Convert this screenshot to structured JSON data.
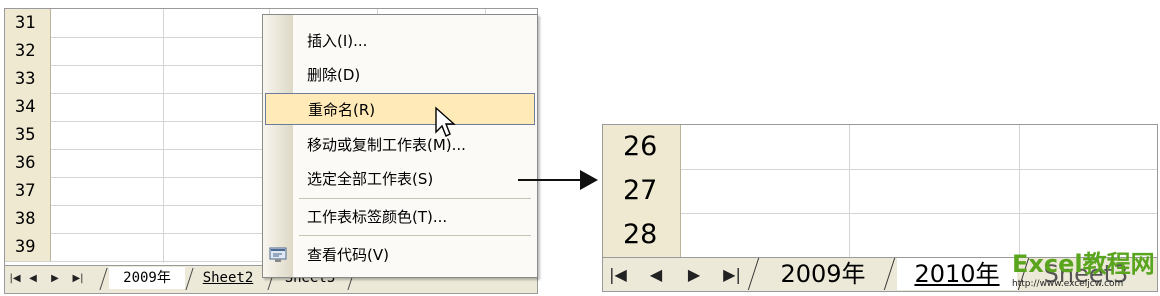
{
  "left_sheet": {
    "row_numbers": [
      "31",
      "32",
      "33",
      "34",
      "35",
      "36",
      "37",
      "38",
      "39"
    ],
    "nav_buttons": [
      "|◀",
      "◀",
      "▶",
      "▶|"
    ],
    "tabs": [
      {
        "label": "2009年",
        "active": true
      },
      {
        "label": "Sheet2",
        "active": false
      },
      {
        "label": "Sheet3",
        "active": false
      }
    ]
  },
  "context_menu": {
    "items": [
      {
        "label": "插入(I)...",
        "highlighted": false,
        "icon": ""
      },
      {
        "label": "删除(D)",
        "highlighted": false,
        "icon": ""
      },
      {
        "label": "重命名(R)",
        "highlighted": true,
        "icon": ""
      },
      {
        "label": "移动或复制工作表(M)...",
        "highlighted": false,
        "icon": ""
      },
      {
        "label": "选定全部工作表(S)",
        "highlighted": false,
        "icon": ""
      },
      {
        "label": "工作表标签颜色(T)...",
        "highlighted": false,
        "icon": ""
      },
      {
        "label": "查看代码(V)",
        "highlighted": false,
        "icon": "view-code-icon"
      }
    ]
  },
  "right_sheet": {
    "row_numbers": [
      "26",
      "27",
      "28"
    ],
    "nav_buttons": [
      "|◀",
      "◀",
      "▶",
      "▶|"
    ],
    "tabs": [
      {
        "label": "2009年",
        "active": false
      },
      {
        "label": "2010年",
        "active": true
      },
      {
        "label": "Sheet3",
        "active": false
      }
    ]
  },
  "watermark": {
    "brand": "Excel教程网",
    "url": "http://www.exceljcw.com",
    "color": "#5aa51e"
  }
}
